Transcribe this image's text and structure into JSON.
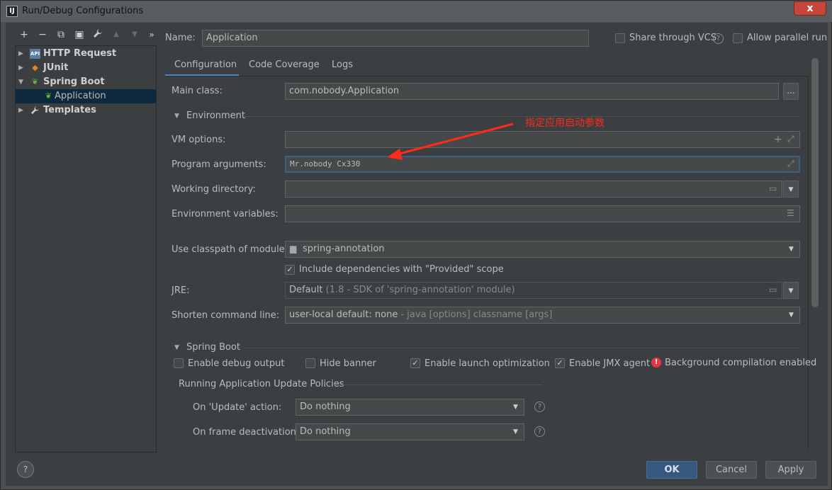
{
  "window": {
    "title": "Run/Debug Configurations",
    "app_icon": "intellij-icon",
    "close": "x"
  },
  "toolbar": {
    "add": "+",
    "remove": "−",
    "copy": "⧉",
    "save": "▣",
    "edit_templates": "🔧",
    "move_up": "▲",
    "move_down": "▼",
    "more": "»"
  },
  "tree": {
    "items": [
      {
        "label": "HTTP Request",
        "icon": "api-icon",
        "expanded": false
      },
      {
        "label": "JUnit",
        "icon": "junit-icon",
        "expanded": false
      },
      {
        "label": "Spring Boot",
        "icon": "spring-boot-icon",
        "expanded": true
      },
      {
        "label": "Application",
        "icon": "spring-boot-app-icon",
        "selected": true
      },
      {
        "label": "Templates",
        "icon": "wrench-icon",
        "expanded": false
      }
    ]
  },
  "name": {
    "label": "Name:",
    "value": "Application"
  },
  "share_vcs": {
    "label": "Share through VCS",
    "checked": false
  },
  "allow_parallel": {
    "label": "Allow parallel run",
    "checked": false
  },
  "tabs": [
    "Configuration",
    "Code Coverage",
    "Logs"
  ],
  "config": {
    "main_class": {
      "label": "Main class:",
      "value": "com.nobody.Application",
      "button": "..."
    },
    "environment_section": "Environment",
    "vm_options": {
      "label": "VM options:",
      "value": ""
    },
    "program_args": {
      "label": "Program arguments:",
      "value": "Mr.nobody Cx330"
    },
    "working_dir": {
      "label": "Working directory:",
      "value": ""
    },
    "env_vars": {
      "label": "Environment variables:",
      "value": ""
    },
    "classpath": {
      "label": "Use classpath of module:",
      "value": "spring-annotation"
    },
    "include_provided": {
      "label": "Include dependencies with \"Provided\" scope",
      "checked": true
    },
    "jre": {
      "label": "JRE:",
      "value": "Default",
      "detail": "(1.8 - SDK of 'spring-annotation' module)"
    },
    "shorten": {
      "label": "Shorten command line:",
      "value": "user-local default: none",
      "detail": "- java [options] classname [args]"
    },
    "spring_boot_section": "Spring Boot",
    "enable_debug": {
      "label": "Enable debug output",
      "checked": false
    },
    "hide_banner": {
      "label": "Hide banner",
      "checked": false
    },
    "launch_opt": {
      "label": "Enable launch optimization",
      "checked": true
    },
    "jmx": {
      "label": "Enable JMX agent",
      "checked": true
    },
    "bg_compilation": "Background compilation enabled",
    "update_policies": "Running Application Update Policies",
    "on_update": {
      "label": "On 'Update' action:",
      "value": "Do nothing"
    },
    "on_frame": {
      "label": "On frame deactivation:",
      "value": "Do nothing"
    }
  },
  "annotation": {
    "text": "指定应用启动参数",
    "color": "#ff2a1a"
  },
  "buttons": {
    "help": "?",
    "ok": "OK",
    "cancel": "Cancel",
    "apply": "Apply"
  }
}
